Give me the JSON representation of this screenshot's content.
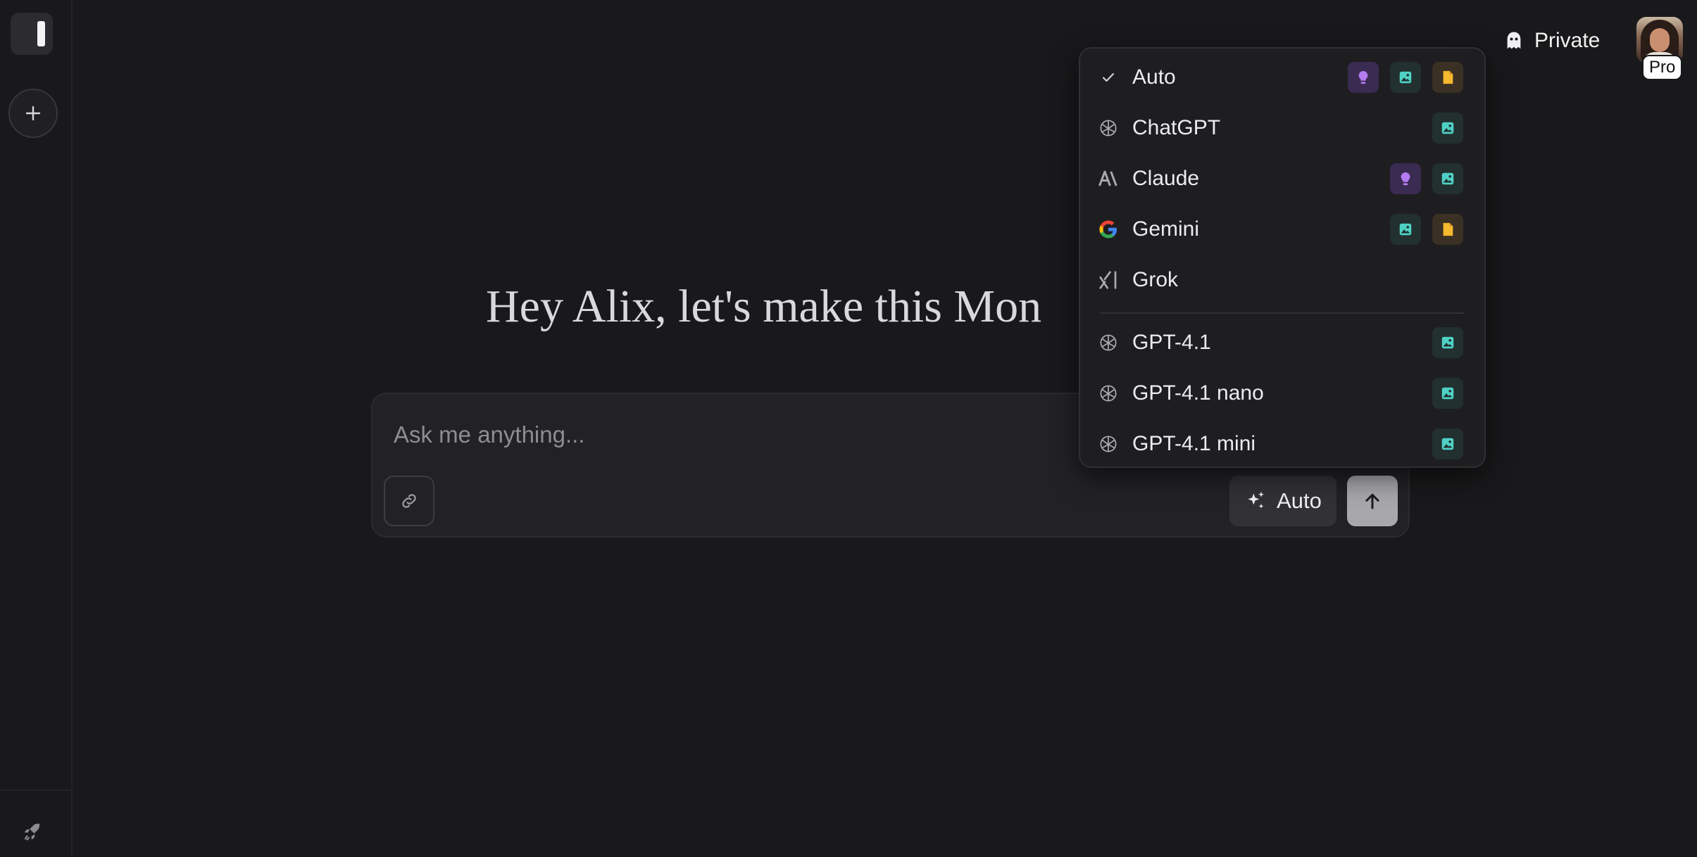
{
  "header": {
    "private_label": "Private",
    "pro_badge": "Pro"
  },
  "greeting": "Hey Alix, let's make this Mon",
  "composer": {
    "placeholder": "Ask me anything...",
    "model_label": "Auto"
  },
  "model_menu": {
    "selected": "Auto",
    "items": [
      {
        "name": "Auto",
        "icon": "check-icon",
        "badges": [
          "reasoning",
          "image",
          "file"
        ]
      },
      {
        "name": "ChatGPT",
        "icon": "openai-icon",
        "badges": [
          "image"
        ]
      },
      {
        "name": "Claude",
        "icon": "anthropic-icon",
        "badges": [
          "reasoning",
          "image"
        ]
      },
      {
        "name": "Gemini",
        "icon": "google-icon",
        "badges": [
          "image",
          "file"
        ]
      },
      {
        "name": "Grok",
        "icon": "xai-icon",
        "badges": []
      },
      {
        "name": "GPT-4.1",
        "icon": "openai-icon",
        "badges": [
          "image"
        ]
      },
      {
        "name": "GPT-4.1 nano",
        "icon": "openai-icon",
        "badges": [
          "image"
        ]
      },
      {
        "name": "GPT-4.1 mini",
        "icon": "openai-icon",
        "badges": [
          "image"
        ]
      }
    ]
  },
  "colors": {
    "background": "#19191b",
    "reasoning_badge": "#b57bf2",
    "image_badge": "#4fd1c5",
    "file_badge": "#f5b82e"
  }
}
